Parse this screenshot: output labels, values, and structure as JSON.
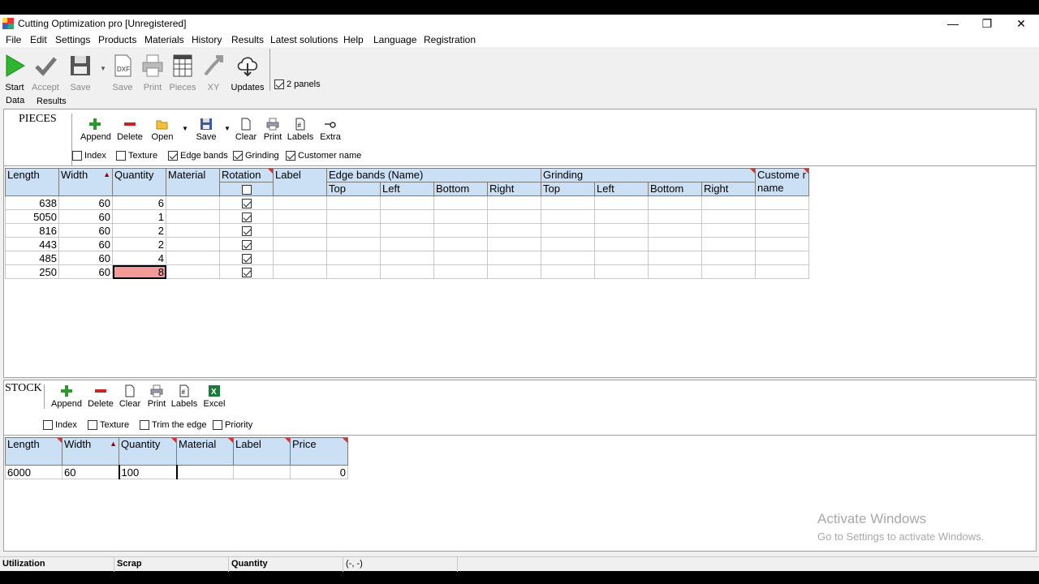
{
  "window": {
    "title": "Cutting Optimization pro [Unregistered]",
    "minimize": "—",
    "restore": "❐",
    "close": "✕"
  },
  "menu": [
    "File",
    "Edit",
    "Settings",
    "Products",
    "Materials",
    "History",
    "Results",
    "Latest solutions",
    "Help",
    "Language",
    "Registration"
  ],
  "toolbar": {
    "start": "Start",
    "accept": "Accept",
    "save": "Save",
    "save_dxf": "Save",
    "print": "Print",
    "pieces": "Pieces",
    "xy": "XY",
    "updates": "Updates",
    "two_panels": {
      "label": "2 panels",
      "checked": true
    }
  },
  "tabs": {
    "data": "Data",
    "results": "Results"
  },
  "pieces": {
    "title": "PIECES",
    "buttons": {
      "append": "Append",
      "delete": "Delete",
      "open": "Open",
      "save": "Save",
      "clear": "Clear",
      "print": "Print",
      "labels": "Labels",
      "extra": "Extra"
    },
    "options": {
      "index": {
        "label": "Index",
        "checked": false
      },
      "texture": {
        "label": "Texture",
        "checked": false
      },
      "edge_bands": {
        "label": "Edge bands",
        "checked": true
      },
      "grinding": {
        "label": "Grinding",
        "checked": true
      },
      "customer_name": {
        "label": "Customer name",
        "checked": true
      }
    },
    "headers": {
      "length": "Length",
      "width": "Width",
      "sort_arrow": "▲",
      "quantity": "Quantity",
      "material": "Material",
      "rotation": "Rotation",
      "label": "Label",
      "edge_bands": "Edge bands (Name)",
      "grinding": "Grinding",
      "customer_name": "Custome r name",
      "top": "Top",
      "left": "Left",
      "bottom": "Bottom",
      "right": "Right"
    },
    "rows": [
      {
        "length": "638",
        "width": "60",
        "quantity": "6",
        "rotation": true
      },
      {
        "length": "5050",
        "width": "60",
        "quantity": "1",
        "rotation": true
      },
      {
        "length": "816",
        "width": "60",
        "quantity": "2",
        "rotation": true
      },
      {
        "length": "443",
        "width": "60",
        "quantity": "2",
        "rotation": true
      },
      {
        "length": "485",
        "width": "60",
        "quantity": "4",
        "rotation": true
      },
      {
        "length": "250",
        "width": "60",
        "quantity": "8",
        "rotation": true
      }
    ]
  },
  "stock": {
    "title": "STOCK",
    "buttons": {
      "append": "Append",
      "delete": "Delete",
      "clear": "Clear",
      "print": "Print",
      "labels": "Labels",
      "excel": "Excel"
    },
    "options": {
      "index": {
        "label": "Index",
        "checked": false
      },
      "texture": {
        "label": "Texture",
        "checked": false
      },
      "trim_edge": {
        "label": "Trim the edge",
        "checked": false
      },
      "priority": {
        "label": "Priority",
        "checked": false
      }
    },
    "headers": {
      "length": "Length",
      "width": "Width",
      "sort_arrow": "▲",
      "quantity": "Quantity",
      "material": "Material",
      "label": "Label",
      "price": "Price"
    },
    "rows": [
      {
        "length": "6000",
        "width": "60",
        "quantity": "100",
        "material": "",
        "label": "",
        "price": "0"
      }
    ]
  },
  "statusbar": {
    "utilization": "Utilization",
    "scrap": "Scrap",
    "quantity": "Quantity",
    "coords": "(-, -)"
  },
  "watermark": {
    "line1": "Activate Windows",
    "line2": "Go to Settings to activate Windows."
  },
  "colors": {
    "header_bg": "#cce0f5",
    "selected_cell": "#f49a9a",
    "start_green": "#2fb52f"
  }
}
